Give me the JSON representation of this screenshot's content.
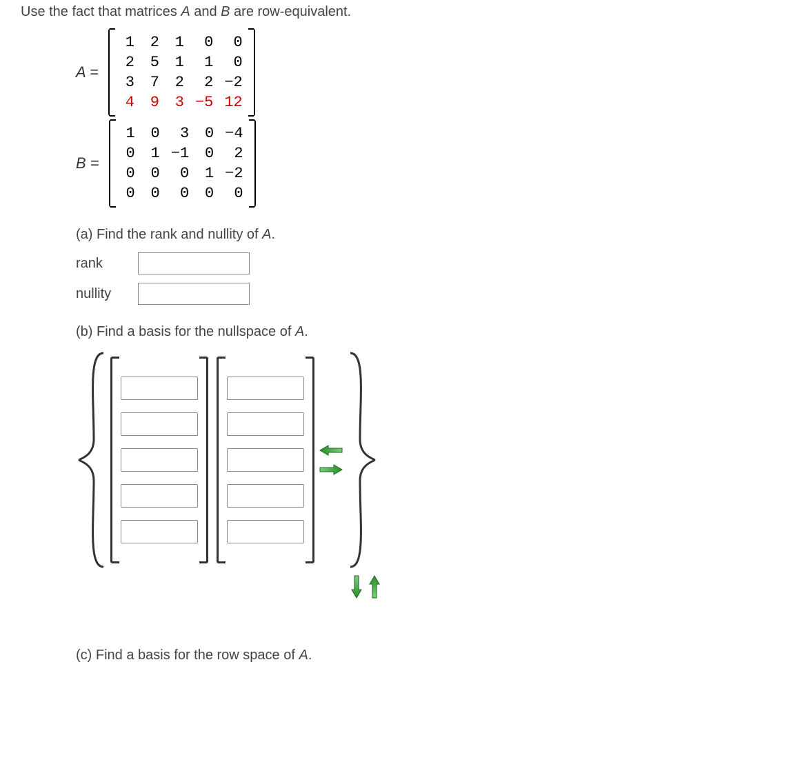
{
  "intro": {
    "prefix": "Use the fact that matrices ",
    "A": "A",
    "mid1": " and ",
    "B": "B",
    "suffix": " are row-equivalent."
  },
  "matrixA": {
    "label": "A = ",
    "rows": [
      [
        "1",
        "2",
        "1",
        "0",
        "0"
      ],
      [
        "2",
        "5",
        "1",
        "1",
        "0"
      ],
      [
        "3",
        "7",
        "2",
        "2",
        "−2"
      ],
      [
        "4",
        "9",
        "3",
        "−5",
        "12"
      ]
    ],
    "red_row_index": 3
  },
  "matrixB": {
    "label": "B = ",
    "rows": [
      [
        "1",
        "0",
        "3",
        "0",
        "−4"
      ],
      [
        "0",
        "1",
        "−1",
        "0",
        "2"
      ],
      [
        "0",
        "0",
        "0",
        "1",
        "−2"
      ],
      [
        "0",
        "0",
        "0",
        "0",
        "0"
      ]
    ]
  },
  "partA": {
    "prompt_prefix": "(a) Find the rank and nullity of ",
    "prompt_var": "A",
    "prompt_suffix": ".",
    "rank_label": "rank",
    "nullity_label": "nullity"
  },
  "partB": {
    "prompt_prefix": "(b) Find a basis for the nullspace of ",
    "prompt_var": "A",
    "prompt_suffix": ".",
    "num_vectors": 2,
    "vector_length": 5
  },
  "partC": {
    "prompt_prefix": "(c) Find a basis for the row space of ",
    "prompt_var": "A",
    "prompt_suffix": "."
  }
}
